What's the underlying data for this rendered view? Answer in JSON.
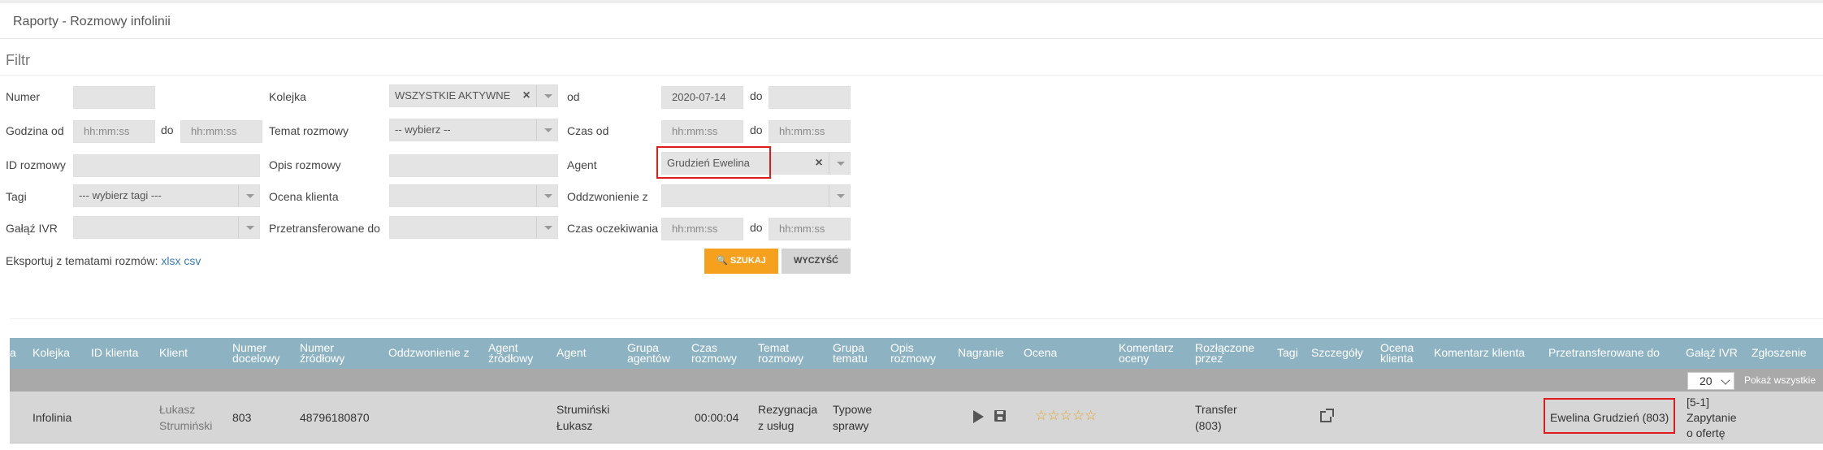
{
  "page": {
    "title": "Raporty - Rozmowy infolinii"
  },
  "filter": {
    "title": "Filtr",
    "numer": {
      "label": "Numer",
      "value": ""
    },
    "kolejka": {
      "label": "Kolejka",
      "value": "WSZYSTKIE AKTYWNE"
    },
    "od": {
      "label": "od",
      "value": "2020-07-14"
    },
    "do_date": {
      "label": "do",
      "value": ""
    },
    "godzina_od": {
      "label": "Godzina od",
      "placeholder": "hh:mm:ss"
    },
    "godzina_do": {
      "label": "do",
      "placeholder": "hh:mm:ss"
    },
    "temat_rozmowy": {
      "label": "Temat rozmowy",
      "value": "-- wybierz --"
    },
    "czas_od": {
      "label": "Czas od",
      "placeholder": "hh:mm:ss"
    },
    "czas_do": {
      "label": "do",
      "placeholder": "hh:mm:ss"
    },
    "id_rozmowy": {
      "label": "ID rozmowy",
      "value": ""
    },
    "opis_rozmowy": {
      "label": "Opis rozmowy",
      "value": ""
    },
    "agent": {
      "label": "Agent",
      "value": "Grudzień Ewelina"
    },
    "tagi": {
      "label": "Tagi",
      "value": "--- wybierz tagi ---"
    },
    "ocena_klienta": {
      "label": "Ocena klienta",
      "value": ""
    },
    "oddzwonienie_z": {
      "label": "Oddzwonienie z",
      "value": ""
    },
    "galaz_ivr": {
      "label": "Gałąź IVR",
      "value": ""
    },
    "przetransferowane_do": {
      "label": "Przetransferowane do",
      "value": ""
    },
    "czas_oczekiwania": {
      "label": "Czas oczekiwania",
      "placeholder": "hh:mm:ss"
    },
    "czas_oczekiwania_do": {
      "label": "do",
      "placeholder": "hh:mm:ss"
    },
    "export_label": "Eksportuj z tematami rozmów:",
    "export_xlsx": "xlsx",
    "export_csv": "csv",
    "search_button": "SZUKAJ",
    "clear_button": "WYCZYŚĆ"
  },
  "table": {
    "columns": [
      "a",
      "Kolejka",
      "ID klienta",
      "Klient",
      "Numer docelowy",
      "Numer źródłowy",
      "Oddzwonienie z",
      "Agent źródłowy",
      "Agent",
      "Grupa agentów",
      "Czas rozmowy",
      "Temat rozmowy",
      "Grupa tematu",
      "Opis rozmowy",
      "Nagranie",
      "Ocena",
      "Komentarz oceny",
      "Rozłączone przez",
      "Tagi",
      "Szczegóły",
      "Ocena klienta",
      "Komentarz klienta",
      "Przetransferowane do",
      "Gałąź IVR",
      "Zgłoszenie"
    ],
    "page_size": "20",
    "show_all": "Pokaż wszystkie",
    "rows": [
      {
        "kolejka": "Infolinia",
        "klient_line1": "Łukasz",
        "klient_line2": "Strumiński",
        "numer_docelowy": "803",
        "numer_zrodlowy": "48796180870",
        "agent_line1": "Strumiński",
        "agent_line2": "Łukasz",
        "czas": "00:00:04",
        "temat_line1": "Rezygnacja",
        "temat_line2": "z usług",
        "grupa_line1": "Typowe",
        "grupa_line2": "sprawy",
        "rozlaczone_line1": "Transfer",
        "rozlaczone_line2": "(803)",
        "przetransferowane": "Ewelina Grudzień (803)",
        "galaz_line1": "[5-1]",
        "galaz_line2": "Zapytanie",
        "galaz_line3": "o ofertę",
        "rating": 0
      }
    ]
  },
  "colors": {
    "header": "#8db3c3",
    "search": "#f6a11d",
    "highlight": "#e01b1b"
  }
}
